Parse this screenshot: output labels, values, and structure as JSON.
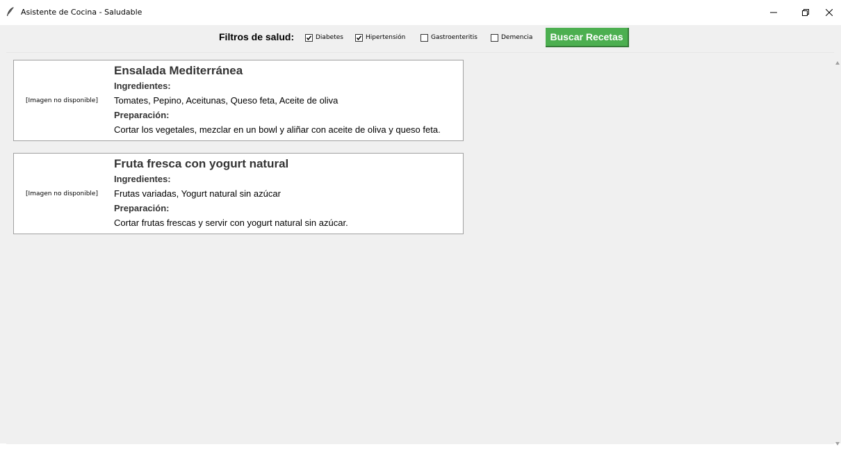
{
  "window": {
    "title": "Asistente de Cocina - Saludable",
    "icon": "feather-icon"
  },
  "filters": {
    "label": "Filtros de salud:",
    "options": [
      {
        "label": "Diabetes",
        "checked": true
      },
      {
        "label": "Hipertensión",
        "checked": true
      },
      {
        "label": "Gastroenteritis",
        "checked": false
      },
      {
        "label": "Demencia",
        "checked": false
      }
    ],
    "search_button": "Buscar Recetas",
    "search_button_color": "#4caf50"
  },
  "recipes": [
    {
      "image_text": "[Imagen no disponible]",
      "title": "Ensalada Mediterránea",
      "ingredients_heading": "Ingredientes:",
      "ingredients": "Tomates, Pepino, Aceitunas, Queso feta, Aceite de oliva",
      "preparation_heading": "Preparación:",
      "preparation": "Cortar los vegetales, mezclar en un bowl y aliñar con aceite de oliva y queso feta."
    },
    {
      "image_text": "[Imagen no disponible]",
      "title": "Fruta fresca con yogurt natural",
      "ingredients_heading": "Ingredientes:",
      "ingredients": "Frutas variadas, Yogurt natural sin azúcar",
      "preparation_heading": "Preparación:",
      "preparation": "Cortar frutas frescas y servir con yogurt natural sin azúcar."
    }
  ]
}
